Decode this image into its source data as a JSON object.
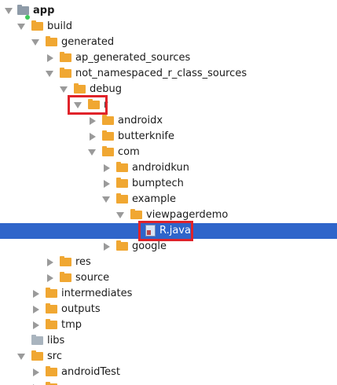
{
  "tree": {
    "app": "app",
    "build": "build",
    "generated": "generated",
    "ap_generated_sources": "ap_generated_sources",
    "not_namespaced": "not_namespaced_r_class_sources",
    "debug": "debug",
    "r": "r",
    "androidx": "androidx",
    "butterknife": "butterknife",
    "com": "com",
    "androidkun": "androidkun",
    "bumptech": "bumptech",
    "example": "example",
    "viewpagerdemo": "viewpagerdemo",
    "r_java": "R.java",
    "google": "google",
    "res": "res",
    "source": "source",
    "intermediates": "intermediates",
    "outputs": "outputs",
    "tmp": "tmp",
    "libs": "libs",
    "src": "src",
    "androidTest": "androidTest"
  },
  "colors": {
    "selection": "#2f65ca",
    "folder": "#f0a732",
    "highlight_box": "#e0232a"
  }
}
